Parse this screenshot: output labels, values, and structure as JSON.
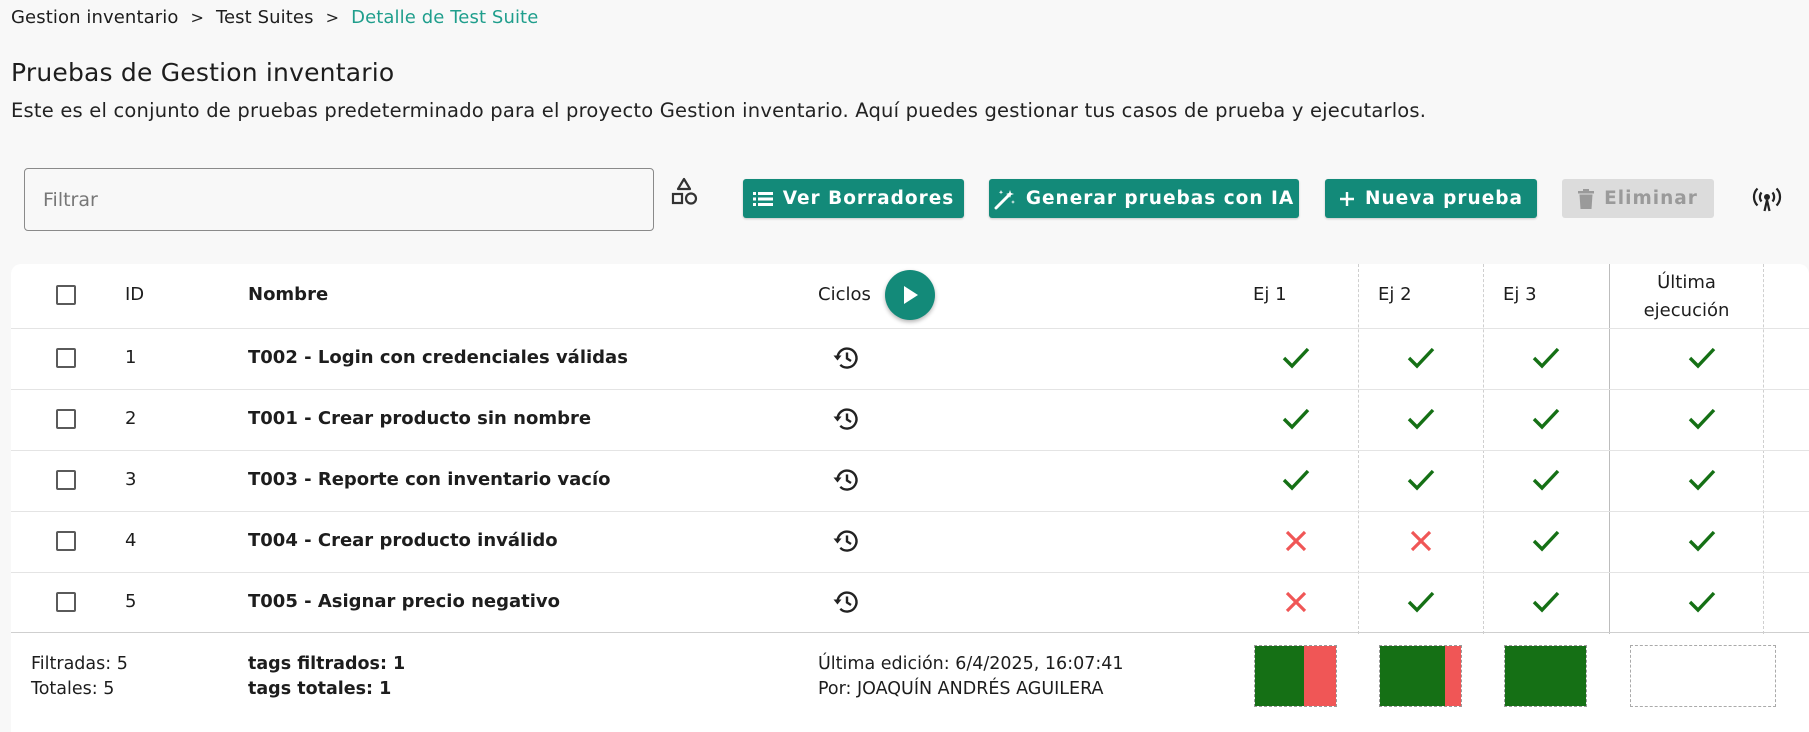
{
  "breadcrumb": {
    "items": [
      "Gestion inventario",
      "Test Suites"
    ],
    "separator": ">",
    "current": "Detalle de Test Suite"
  },
  "page": {
    "title": "Pruebas de Gestion inventario",
    "description": "Este es el conjunto de pruebas predeterminado para el proyecto Gestion inventario. Aquí puedes gestionar tus casos de prueba y ejecutarlos."
  },
  "toolbar": {
    "filter_placeholder": "Filtrar",
    "drafts_label": "Ver Borradores",
    "ai_label": "Generar pruebas con IA",
    "new_label": "Nueva prueba",
    "delete_label": "Eliminar",
    "delete_disabled": true
  },
  "table": {
    "headers": {
      "id": "ID",
      "name": "Nombre",
      "cycles": "Ciclos",
      "run1": "Ej 1",
      "run2": "Ej 2",
      "run3": "Ej 3",
      "last_line1": "Última",
      "last_line2": "ejecución"
    },
    "rows": [
      {
        "id": "1",
        "name": "T002 - Login con credenciales válidas",
        "results": [
          "pass",
          "pass",
          "pass",
          "pass"
        ]
      },
      {
        "id": "2",
        "name": "T001 - Crear producto sin nombre",
        "results": [
          "pass",
          "pass",
          "pass",
          "pass"
        ]
      },
      {
        "id": "3",
        "name": "T003 - Reporte con inventario vacío",
        "results": [
          "pass",
          "pass",
          "pass",
          "pass"
        ]
      },
      {
        "id": "4",
        "name": "T004 - Crear producto inválido",
        "results": [
          "fail",
          "fail",
          "pass",
          "pass"
        ]
      },
      {
        "id": "5",
        "name": "T005 - Asignar precio negativo",
        "results": [
          "fail",
          "pass",
          "pass",
          "pass"
        ]
      }
    ]
  },
  "footer": {
    "filtered": "Filtradas: 5",
    "totals": "Totales: 5",
    "tags_filtered": "tags filtrados: 1",
    "tags_total": "tags totales: 1",
    "last_edit": "Última edición: 6/4/2025, 16:07:41",
    "edited_by": "Por: JOAQUÍN ANDRÉS AGUILERA",
    "run_summaries": [
      {
        "run": "Ej 1",
        "pass_fraction": 0.6,
        "fail_fraction": 0.4
      },
      {
        "run": "Ej 2",
        "pass_fraction": 0.8,
        "fail_fraction": 0.2
      },
      {
        "run": "Ej 3",
        "pass_fraction": 1.0,
        "fail_fraction": 0.0
      },
      {
        "run": "Última ejecución",
        "pass_fraction": 0,
        "fail_fraction": 0
      }
    ]
  },
  "colors": {
    "accent": "#138a79",
    "breadcrumb_current": "#1f9e8c",
    "pass": "#157015",
    "fail": "#f05656",
    "disabled_bg": "#dcdcdc"
  }
}
